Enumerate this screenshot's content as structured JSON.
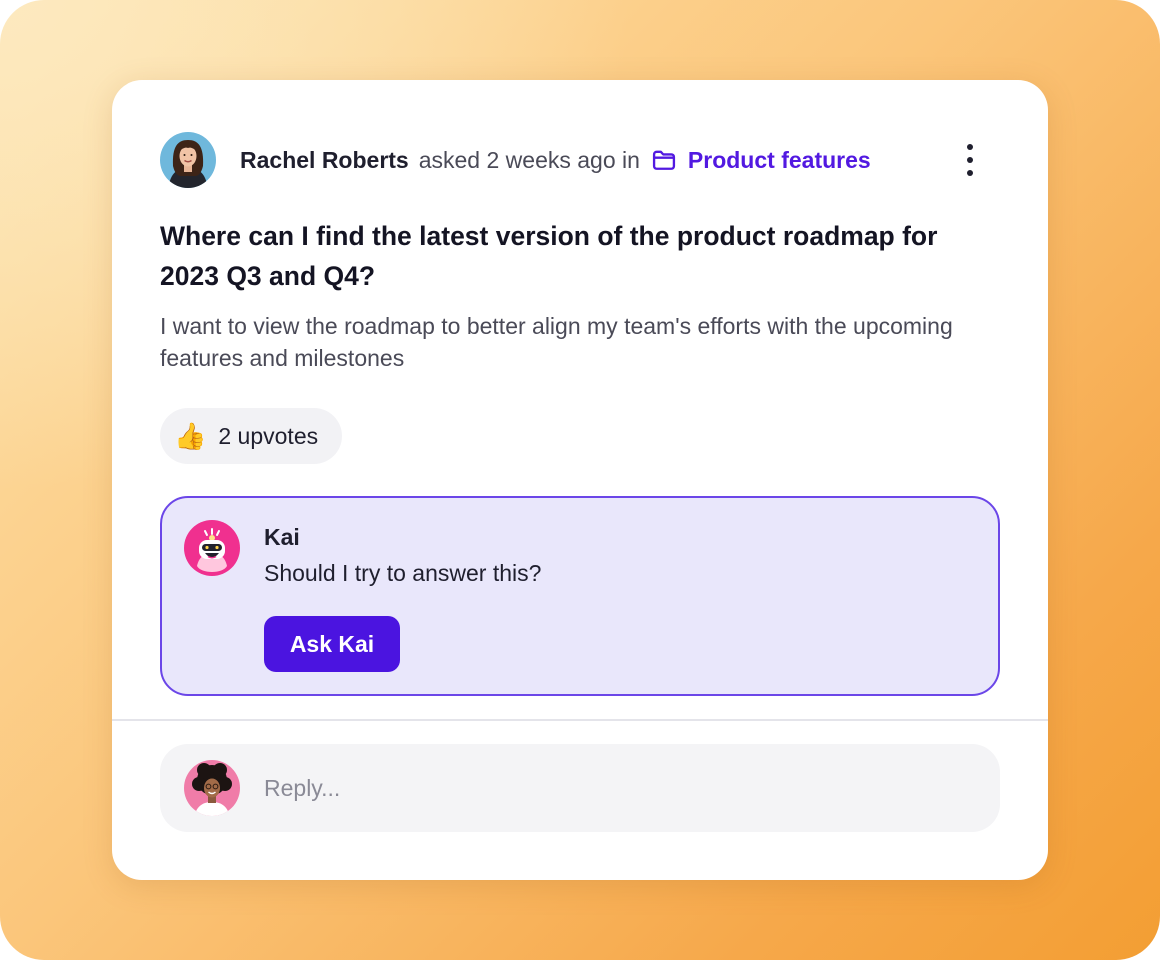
{
  "post": {
    "author_name": "Rachel Roberts",
    "meta_text": "asked 2 weeks ago in",
    "category": "Product features",
    "category_icon": "folder-icon",
    "more_icon": "more-vertical-icon",
    "title": "Where can I find the latest version of the product roadmap for 2023 Q3 and Q4?",
    "body": "I want to view the roadmap to better align my team's efforts with the upcoming features and milestones",
    "upvote_icon": "👍",
    "upvotes_label": "2 upvotes"
  },
  "assistant": {
    "name": "Kai",
    "message": "Should I try to answer this?",
    "button_label": "Ask Kai",
    "avatar_icon": "robot-avatar-icon"
  },
  "reply": {
    "placeholder": "Reply...",
    "value": ""
  },
  "colors": {
    "accent": "#5219e1",
    "button": "#4b14e0",
    "assistant_bg": "#e9e7fb",
    "assistant_border": "#6b46e8",
    "background_gradient_start": "#fde3ac",
    "background_gradient_end": "#f39e33"
  }
}
